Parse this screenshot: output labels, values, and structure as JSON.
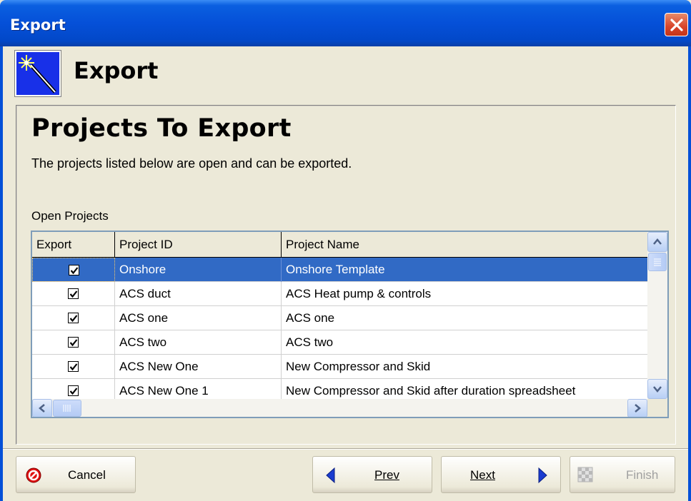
{
  "window": {
    "title": "Export"
  },
  "header": {
    "title": "Export",
    "icon": "magic-wand-icon"
  },
  "section": {
    "title": "Projects To Export",
    "description": "The projects listed below are open and can be exported."
  },
  "open_projects": {
    "label": "Open Projects",
    "columns": [
      "Export",
      "Project ID",
      "Project Name"
    ],
    "rows": [
      {
        "export": true,
        "id": "Onshore",
        "name": "Onshore Template",
        "selected": true
      },
      {
        "export": true,
        "id": "ACS duct",
        "name": "ACS Heat pump & controls"
      },
      {
        "export": true,
        "id": "ACS one",
        "name": "ACS one"
      },
      {
        "export": true,
        "id": "ACS two",
        "name": "ACS two"
      },
      {
        "export": true,
        "id": "ACS New One",
        "name": "New Compressor and Skid"
      },
      {
        "export": true,
        "id": "ACS New One 1",
        "name": "New Compressor and Skid after duration spreadsheet"
      }
    ]
  },
  "buttons": {
    "cancel": "Cancel",
    "prev": "Prev",
    "next": "Next",
    "finish": "Finish"
  },
  "colors": {
    "titlebar": "#0550d8",
    "selection": "#316ac5",
    "dialog_bg": "#ece9d8"
  }
}
